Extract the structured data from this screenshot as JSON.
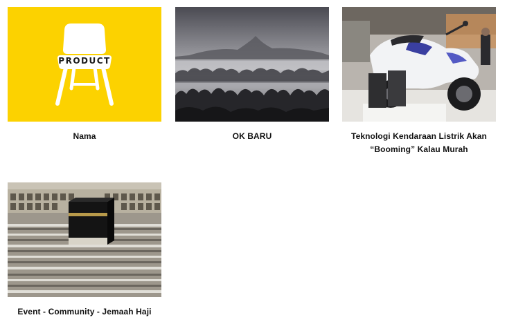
{
  "items": [
    {
      "caption": "Nama",
      "image_label": "PRODUCT",
      "accent": "#fcd200",
      "icon": "chair-icon"
    },
    {
      "caption": "OK BARU",
      "icon": "misty-forest-temple-image"
    },
    {
      "caption": "Teknologi Kendaraan Listrik Akan “Booming” Kalau Murah",
      "icon": "electric-scooter-image"
    },
    {
      "caption": "Event - Community - Jemaah Haji",
      "icon": "kaaba-crowd-image"
    }
  ]
}
